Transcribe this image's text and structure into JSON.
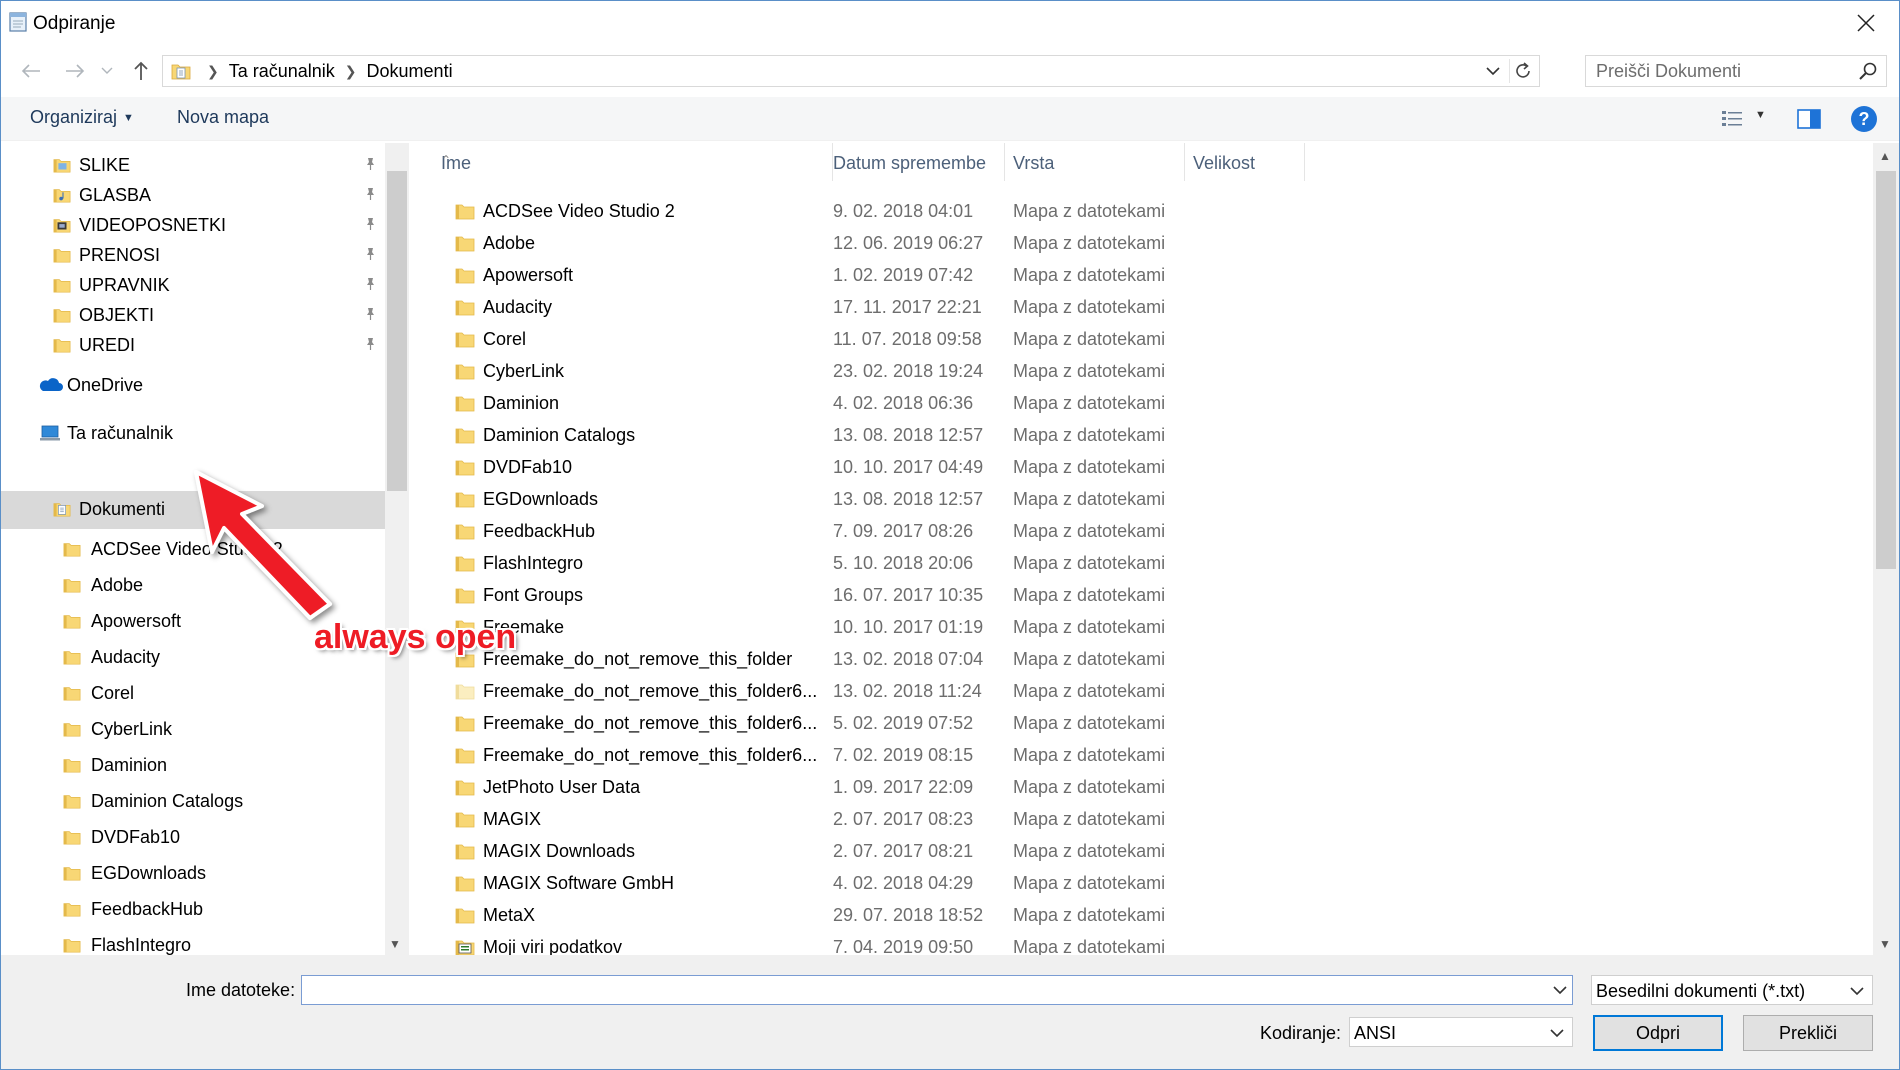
{
  "window": {
    "title": "Odpiranje"
  },
  "address": {
    "crumbs": [
      "Ta računalnik",
      "Dokumenti"
    ],
    "search_placeholder": "Preišči Dokumenti"
  },
  "toolbar": {
    "organize_label": "Organiziraj",
    "new_folder_label": "Nova mapa",
    "help_label": "?"
  },
  "nav": {
    "pinned": [
      {
        "label": "SLIKE",
        "icon": "pictures-folder-icon"
      },
      {
        "label": "GLASBA",
        "icon": "music-folder-icon"
      },
      {
        "label": "VIDEOPOSNETKI",
        "icon": "videos-folder-icon"
      },
      {
        "label": "PRENOSI",
        "icon": "folder-icon"
      },
      {
        "label": "UPRAVNIK",
        "icon": "folder-icon"
      },
      {
        "label": "OBJEKTI",
        "icon": "folder-icon"
      },
      {
        "label": "UREDI",
        "icon": "folder-icon"
      }
    ],
    "onedrive_label": "OneDrive",
    "this_pc_label": "Ta računalnik",
    "documents_label": "Dokumenti",
    "subfolders": [
      "ACDSee Video Studio 2",
      "Adobe",
      "Apowersoft",
      "Audacity",
      "Corel",
      "CyberLink",
      "Daminion",
      "Daminion Catalogs",
      "DVDFab10",
      "EGDownloads",
      "FeedbackHub",
      "FlashIntegro"
    ]
  },
  "columns": {
    "name": "Ime",
    "date": "Datum spremembe",
    "type": "Vrsta",
    "size": "Velikost"
  },
  "files": [
    {
      "name": "ACDSee Video Studio 2",
      "date": "9. 02. 2018 04:01",
      "type": "Mapa z datotekami"
    },
    {
      "name": "Adobe",
      "date": "12. 06. 2019 06:27",
      "type": "Mapa z datotekami"
    },
    {
      "name": "Apowersoft",
      "date": "1. 02. 2019 07:42",
      "type": "Mapa z datotekami"
    },
    {
      "name": "Audacity",
      "date": "17. 11. 2017 22:21",
      "type": "Mapa z datotekami"
    },
    {
      "name": "Corel",
      "date": "11. 07. 2018 09:58",
      "type": "Mapa z datotekami"
    },
    {
      "name": "CyberLink",
      "date": "23. 02. 2018 19:24",
      "type": "Mapa z datotekami"
    },
    {
      "name": "Daminion",
      "date": "4. 02. 2018 06:36",
      "type": "Mapa z datotekami"
    },
    {
      "name": "Daminion Catalogs",
      "date": "13. 08. 2018 12:57",
      "type": "Mapa z datotekami"
    },
    {
      "name": "DVDFab10",
      "date": "10. 10. 2017 04:49",
      "type": "Mapa z datotekami"
    },
    {
      "name": "EGDownloads",
      "date": "13. 08. 2018 12:57",
      "type": "Mapa z datotekami"
    },
    {
      "name": "FeedbackHub",
      "date": "7. 09. 2017 08:26",
      "type": "Mapa z datotekami"
    },
    {
      "name": "FlashIntegro",
      "date": "5. 10. 2018 20:06",
      "type": "Mapa z datotekami"
    },
    {
      "name": "Font Groups",
      "date": "16. 07. 2017 10:35",
      "type": "Mapa z datotekami"
    },
    {
      "name": "Freemake",
      "date": "10. 10. 2017 01:19",
      "type": "Mapa z datotekami"
    },
    {
      "name": "Freemake_do_not_remove_this_folder",
      "date": "13. 02. 2018 07:04",
      "type": "Mapa z datotekami"
    },
    {
      "name": "Freemake_do_not_remove_this_folder6...",
      "date": "13. 02. 2018 11:24",
      "type": "Mapa z datotekami",
      "faded": true
    },
    {
      "name": "Freemake_do_not_remove_this_folder6...",
      "date": "5. 02. 2019 07:52",
      "type": "Mapa z datotekami"
    },
    {
      "name": "Freemake_do_not_remove_this_folder6...",
      "date": "7. 02. 2019 08:15",
      "type": "Mapa z datotekami"
    },
    {
      "name": "JetPhoto User Data",
      "date": "1. 09. 2017 22:09",
      "type": "Mapa z datotekami"
    },
    {
      "name": "MAGIX",
      "date": "2. 07. 2017 08:23",
      "type": "Mapa z datotekami"
    },
    {
      "name": "MAGIX Downloads",
      "date": "2. 07. 2017 08:21",
      "type": "Mapa z datotekami"
    },
    {
      "name": "MAGIX Software GmbH",
      "date": "4. 02. 2018 04:29",
      "type": "Mapa z datotekami"
    },
    {
      "name": "MetaX",
      "date": "29. 07. 2018 18:52",
      "type": "Mapa z datotekami"
    },
    {
      "name": "Moji viri podatkov",
      "date": "7. 04. 2019 09:50",
      "type": "Mapa z datotekami",
      "special": true
    }
  ],
  "bottom": {
    "filename_label": "Ime datoteke:",
    "filename_value": "",
    "filetype_value": "Besedilni dokumenti (*.txt)",
    "encoding_label": "Kodiranje:",
    "encoding_value": "ANSI",
    "open_label": "Odpri",
    "cancel_label": "Prekliči"
  },
  "annotation": {
    "text": "always open"
  },
  "colors": {
    "folder": "#f8d775",
    "folder_dark": "#e4b94a",
    "accent": "#0078d7",
    "annotation": "#ee1c25",
    "selected": "#d9d9d9"
  }
}
